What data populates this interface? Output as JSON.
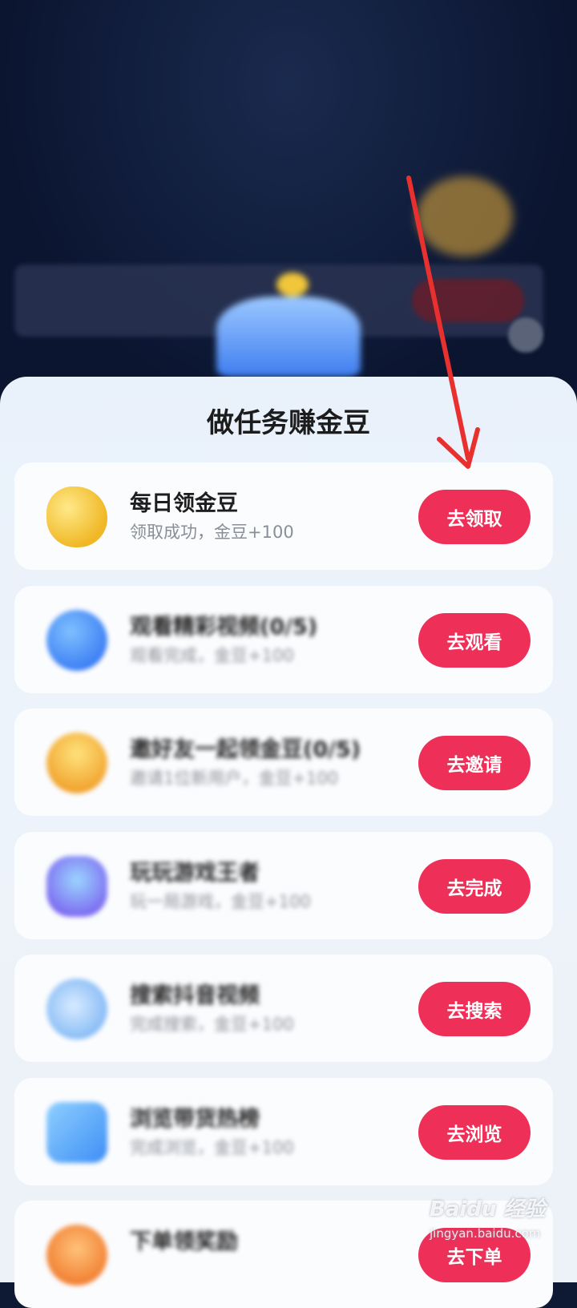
{
  "sheet": {
    "title": "做任务赚金豆"
  },
  "tasks": [
    {
      "name": "每日领金豆",
      "desc": "领取成功，金豆+100",
      "button": "去领取",
      "icon": "gold-bean-icon"
    },
    {
      "name": "观看精彩视频(0/5)",
      "desc": "观看完成，金豆+100",
      "button": "去观看",
      "icon": "play-icon"
    },
    {
      "name": "邀好友一起领金豆(0/5)",
      "desc": "邀请1位新用户，金豆+100",
      "button": "去邀请",
      "icon": "lightbulb-icon"
    },
    {
      "name": "玩玩游戏王者",
      "desc": "玩一局游戏，金豆+100",
      "button": "去完成",
      "icon": "gamepad-icon"
    },
    {
      "name": "搜索抖音视频",
      "desc": "完成搜索，金豆+100",
      "button": "去搜索",
      "icon": "search-icon"
    },
    {
      "name": "浏览带货热榜",
      "desc": "完成浏览，金豆+100",
      "button": "去浏览",
      "icon": "hot-list-icon"
    },
    {
      "name": "下单领奖励",
      "desc": "",
      "button": "去下单",
      "icon": "download-icon"
    }
  ],
  "watermark": {
    "brand": "Baidu 经验",
    "url": "jingyan.baidu.com"
  }
}
